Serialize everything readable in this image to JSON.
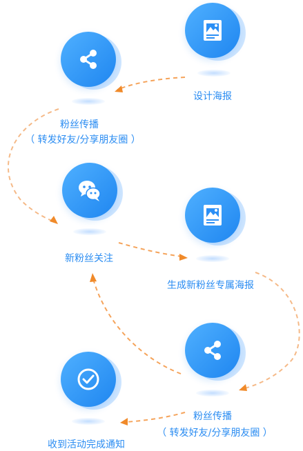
{
  "colors": {
    "node_blue": "#2b8ff5",
    "label_blue": "#2a8cf2",
    "arrow_orange": "#f08a2a"
  },
  "steps": [
    {
      "icon": "poster-icon",
      "label": "设计海报"
    },
    {
      "icon": "share-icon",
      "label": "粉丝传播",
      "sublabel": "（ 转发好友/分享朋友圈 ）"
    },
    {
      "icon": "wechat-icon",
      "label": "新粉丝关注"
    },
    {
      "icon": "poster-icon",
      "label": "生成新粉丝专属海报"
    },
    {
      "icon": "share-icon",
      "label": "粉丝传播",
      "sublabel": "（ 转发好友/分享朋友圈 ）"
    },
    {
      "icon": "check-icon",
      "label": "收到活动完成通知"
    }
  ]
}
